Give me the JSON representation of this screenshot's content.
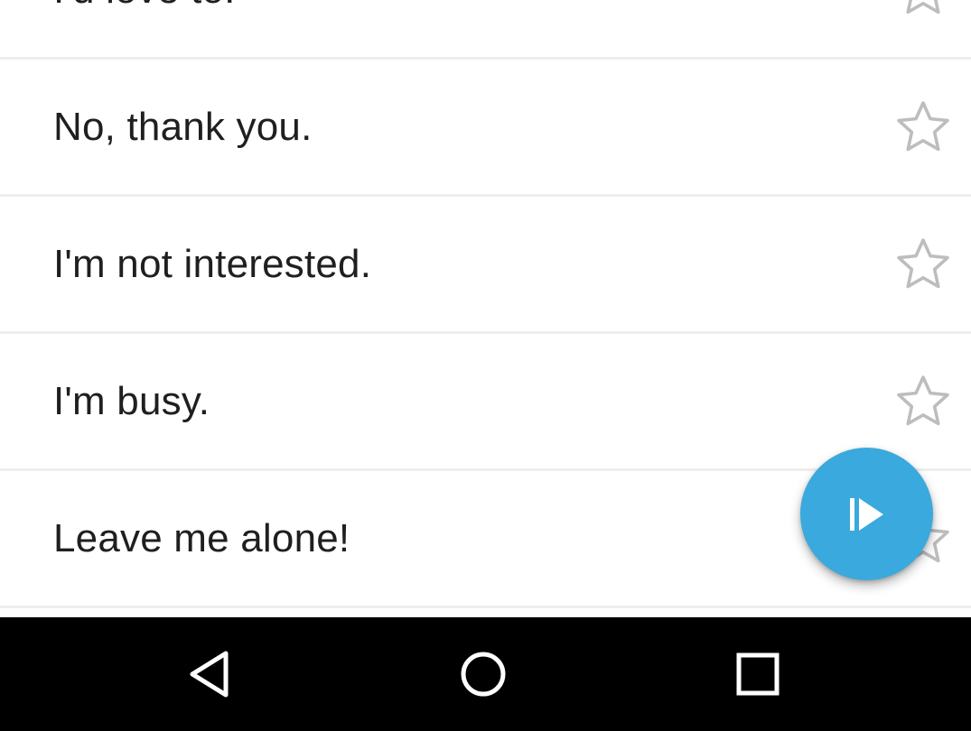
{
  "phrases": [
    {
      "text": "I'd love to.",
      "starred": false
    },
    {
      "text": "No, thank you.",
      "starred": false
    },
    {
      "text": "I'm not interested.",
      "starred": false
    },
    {
      "text": "I'm busy.",
      "starred": false
    },
    {
      "text": "Leave me alone!",
      "starred": false
    }
  ],
  "fab": {
    "icon": "play-icon",
    "color": "#3aa9dd"
  },
  "navbar": {
    "buttons": [
      "back-icon",
      "home-icon",
      "recents-icon"
    ],
    "background": "#000000"
  },
  "colors": {
    "text": "#1f1f1f",
    "divider": "#eeeeee",
    "star_outline": "#bdbdbd"
  }
}
